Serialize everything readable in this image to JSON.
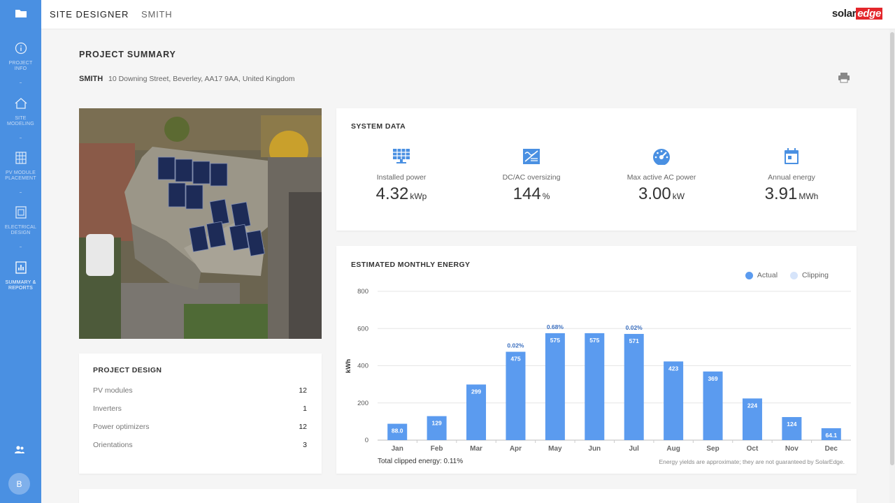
{
  "sidebar": {
    "items": [
      {
        "label": "PROJECT INFO",
        "icon": "info-icon"
      },
      {
        "label": "SITE MODELING",
        "icon": "home-icon"
      },
      {
        "label": "PV MODULE PLACEMENT",
        "icon": "grid-icon"
      },
      {
        "label": "ELECTRICAL DESIGN",
        "icon": "circuit-icon"
      },
      {
        "label": "SUMMARY & REPORTS",
        "icon": "report-icon"
      }
    ],
    "avatar": "B"
  },
  "topbar": {
    "app_title": "SITE DESIGNER",
    "project_name": "SMITH",
    "logo_left": "solar",
    "logo_right": "edge"
  },
  "summary": {
    "title": "PROJECT SUMMARY",
    "client": "SMITH",
    "address": "10 Downing Street, Beverley, AA17 9AA, United Kingdom"
  },
  "project_design": {
    "title": "PROJECT DESIGN",
    "rows": [
      {
        "label": "PV modules",
        "value": "12"
      },
      {
        "label": "Inverters",
        "value": "1"
      },
      {
        "label": "Power optimizers",
        "value": "12"
      },
      {
        "label": "Orientations",
        "value": "3"
      }
    ]
  },
  "system_data": {
    "title": "SYSTEM DATA",
    "metrics": [
      {
        "label": "Installed power",
        "value": "4.32",
        "unit": "kWp",
        "icon": "solar-panel-icon"
      },
      {
        "label": "DC/AC oversizing",
        "value": "144",
        "unit": "%",
        "icon": "oversizing-icon"
      },
      {
        "label": "Max active AC power",
        "value": "3.00",
        "unit": "kW",
        "icon": "gauge-icon"
      },
      {
        "label": "Annual energy",
        "value": "3.91",
        "unit": "MWh",
        "icon": "calendar-icon"
      }
    ]
  },
  "energy": {
    "title": "ESTIMATED MONTHLY ENERGY",
    "legend_actual": "Actual",
    "legend_clipping": "Clipping",
    "clipped_note": "Total clipped energy: 0.11%",
    "disclaimer": "Energy yields are approximate; they are not guaranteed by SolarEdge."
  },
  "chart_data": {
    "type": "bar",
    "ylabel": "kWh",
    "ylim": [
      0,
      800
    ],
    "yticks": [
      0,
      200,
      400,
      600,
      800
    ],
    "categories": [
      "Jan",
      "Feb",
      "Mar",
      "Apr",
      "May",
      "Jun",
      "Jul",
      "Aug",
      "Sep",
      "Oct",
      "Nov",
      "Dec"
    ],
    "series": [
      {
        "name": "Actual",
        "values": [
          88.0,
          129,
          299,
          475,
          575,
          575,
          571,
          423,
          369,
          224,
          124,
          64.1
        ],
        "labels": [
          "88.0",
          "129",
          "299",
          "475",
          "575",
          "575",
          "571",
          "423",
          "369",
          "224",
          "124",
          "64.1"
        ]
      }
    ],
    "clipping_labels": [
      "",
      "",
      "",
      "0.02%",
      "0.68%",
      "",
      "0.02%",
      "",
      "",
      "",
      "",
      ""
    ],
    "grid": true,
    "legend_position": "top-right",
    "colors": {
      "actual": "#5b9bef",
      "clipping": "#d6e4fa",
      "clip_text": "#3b6fbf"
    }
  }
}
